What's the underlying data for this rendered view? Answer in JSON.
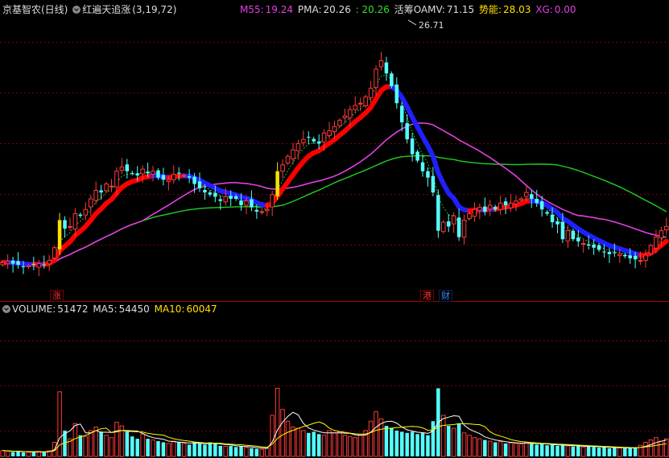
{
  "header": {
    "stock_name": "京基智农(日线)",
    "indicator_name": "红遍天追涨",
    "indicator_params": "(3,19,72)",
    "m55_label": "M55:",
    "m55_value": "19.24",
    "pma_label": "PMA:",
    "pma_value": "20.26",
    "green_value": ": 20.26",
    "oamv_label": "活筹OAMV:",
    "oamv_value": "71.15",
    "energy_label": "势能:",
    "energy_value": "28.03",
    "xg_label": "XG:",
    "xg_value": "0.00"
  },
  "volume_header": {
    "volume_label": "VOLUME:",
    "volume_value": "51472",
    "ma5_label": "MA5:",
    "ma5_value": "54450",
    "ma10_label": "MA10:",
    "ma10_value": "60047"
  },
  "annotations": {
    "peak_label": "26.71",
    "tag_zhang": "涨",
    "tag_gang": "港",
    "tag_cai": "财"
  },
  "colors": {
    "up": "#ff3a3a",
    "down": "#54ffff",
    "trend_up": "#ff0000",
    "trend_down": "#2020ff",
    "ma_magenta": "#e040e0",
    "ma_green": "#20d020",
    "signal_yellow": "#ffe000",
    "grid": "#7a0000",
    "vol_white": "#ffffff",
    "vol_yellow": "#ffff00"
  },
  "chart_data": {
    "type": "candlestick",
    "ylim": [
      15.5,
      28.0
    ],
    "volume_ylim": [
      0,
      120000
    ],
    "price_close": [
      16.4,
      16.45,
      16.35,
      16.3,
      16.2,
      16.25,
      16.3,
      16.35,
      16.3,
      16.5,
      17.1,
      18.4,
      18.0,
      18.1,
      18.7,
      18.6,
      18.9,
      19.4,
      19.8,
      19.7,
      20.1,
      20.0,
      20.7,
      20.9,
      20.7,
      20.6,
      20.5,
      20.8,
      20.6,
      20.7,
      20.4,
      20.3,
      20.3,
      20.55,
      20.6,
      20.5,
      20.4,
      20.1,
      19.9,
      19.7,
      19.6,
      19.5,
      19.3,
      19.5,
      19.4,
      19.4,
      19.1,
      19.3,
      19.0,
      18.8,
      18.8,
      18.9,
      19.6,
      20.7,
      21.0,
      21.4,
      21.7,
      22.0,
      22.2,
      22.3,
      22.1,
      22.0,
      22.5,
      22.6,
      22.8,
      23.1,
      23.3,
      23.6,
      23.8,
      23.9,
      24.2,
      24.6,
      25.5,
      25.9,
      25.3,
      24.7,
      23.9,
      23.0,
      22.2,
      21.5,
      21.2,
      20.7,
      20.4,
      19.7,
      17.9,
      18.3,
      18.1,
      18.6,
      17.6,
      18.4,
      18.7,
      18.9,
      19.0,
      18.8,
      19.1,
      18.9,
      19.2,
      19.1,
      19.2,
      19.3,
      19.4,
      19.7,
      19.4,
      19.2,
      18.9,
      18.7,
      18.3,
      18.2,
      17.5,
      17.9,
      17.5,
      17.4,
      17.3,
      17.2,
      17.1,
      17.0,
      16.9,
      16.8,
      16.85,
      16.8,
      16.7,
      16.6,
      16.55,
      16.5,
      16.75,
      17.2,
      17.6,
      17.9,
      18.1
    ],
    "volume": [
      5000,
      4500,
      3800,
      4200,
      3500,
      3600,
      3900,
      4000,
      3500,
      4800,
      12000,
      55000,
      22000,
      15000,
      28000,
      18000,
      17000,
      22000,
      25000,
      21000,
      18000,
      16000,
      29000,
      26000,
      21000,
      17000,
      15000,
      19000,
      15000,
      14000,
      13000,
      12000,
      11000,
      13000,
      12000,
      11000,
      10000,
      12000,
      11000,
      10000,
      12000,
      11000,
      9000,
      8500,
      9000,
      8000,
      8800,
      7500,
      7000,
      6500,
      6000,
      7000,
      35000,
      58000,
      40000,
      30000,
      25000,
      24000,
      22000,
      20000,
      21000,
      19000,
      18000,
      22000,
      20000,
      21000,
      18000,
      17000,
      16000,
      18000,
      22000,
      30000,
      38000,
      32000,
      26000,
      24000,
      22000,
      21000,
      20000,
      21000,
      19000,
      20000,
      18000,
      30000,
      58000,
      35000,
      26000,
      24000,
      28000,
      20000,
      18000,
      16000,
      15000,
      14000,
      13000,
      12000,
      12500,
      11000,
      11500,
      11000,
      10500,
      12000,
      11000,
      10000,
      10500,
      9500,
      10000,
      9000,
      9500,
      9000,
      8500,
      9000,
      8000,
      8500,
      8000,
      7500,
      8000,
      7000,
      7500,
      7200,
      7000,
      6800,
      7500,
      9500,
      12000,
      14000,
      16000,
      13000,
      15000
    ]
  }
}
